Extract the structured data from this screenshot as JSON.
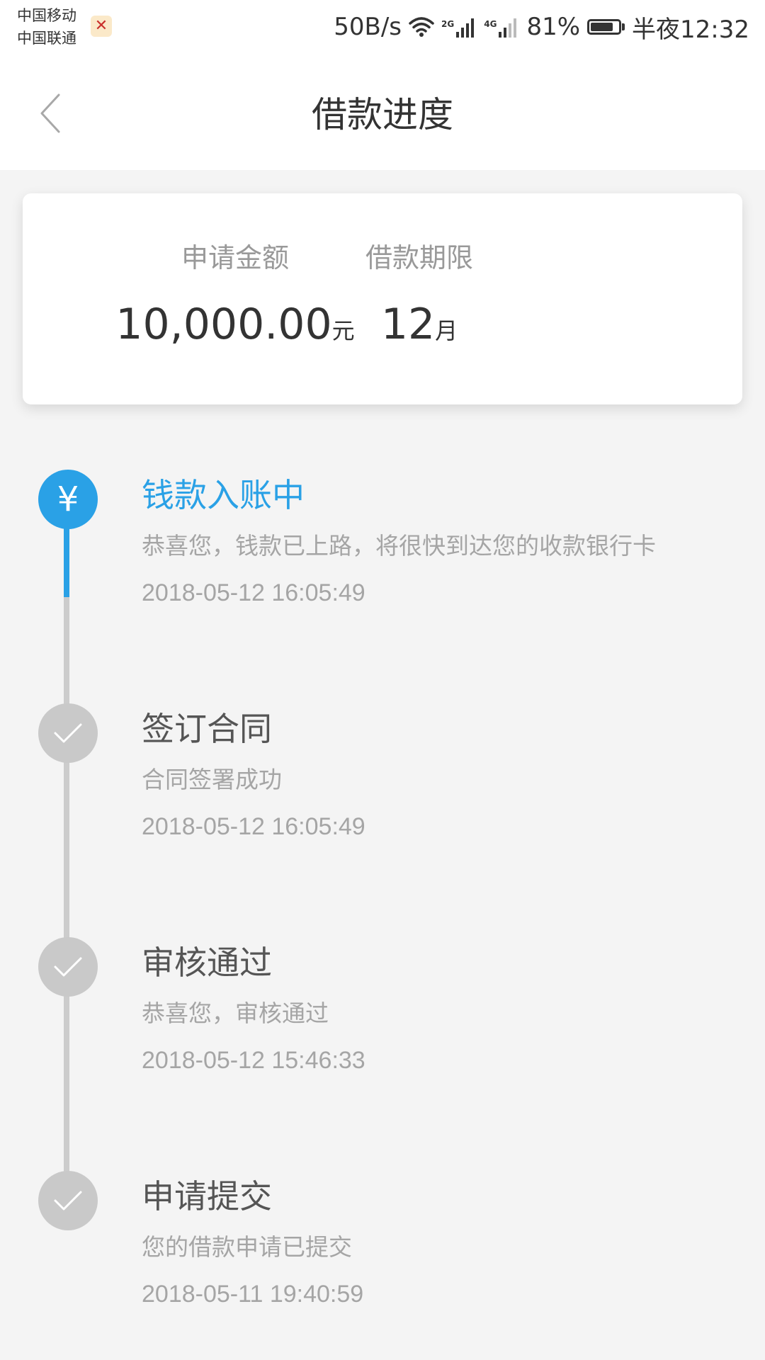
{
  "status_bar": {
    "carrier_1": "中国移动",
    "carrier_2": "中国联通",
    "net_speed": "50B/s",
    "net_tag_1": "2G",
    "net_tag_2": "4G",
    "battery_percent": "81%",
    "battery_level": 0.81,
    "time": "半夜12:32",
    "icons": [
      "wifi-icon",
      "signal-icon",
      "signal-icon",
      "battery-icon"
    ]
  },
  "nav": {
    "title": "借款进度",
    "back_icon": "chevron-left-icon"
  },
  "summary": {
    "amount_label": "申请金额",
    "amount_value": "10,000.00",
    "amount_unit": "元",
    "term_label": "借款期限",
    "term_value": "12",
    "term_unit": "月"
  },
  "colors": {
    "accent": "#2aa1e6",
    "inactive": "#c9c9c9",
    "text_primary": "#333333",
    "text_secondary": "#a5a5a5",
    "background": "#f4f4f4"
  },
  "timeline": [
    {
      "title": "钱款入账中",
      "desc": "恭喜您，钱款已上路，将很快到达您的收款银行卡",
      "time": "2018-05-12 16:05:49",
      "active": true,
      "icon": "yen-icon",
      "icon_glyph": "¥"
    },
    {
      "title": "签订合同",
      "desc": "合同签署成功",
      "time": "2018-05-12 16:05:49",
      "active": false,
      "icon": "check-icon"
    },
    {
      "title": "审核通过",
      "desc": "恭喜您，审核通过",
      "time": "2018-05-12 15:46:33",
      "active": false,
      "icon": "check-icon"
    },
    {
      "title": "申请提交",
      "desc": "您的借款申请已提交",
      "time": "2018-05-11 19:40:59",
      "active": false,
      "icon": "check-icon"
    }
  ]
}
